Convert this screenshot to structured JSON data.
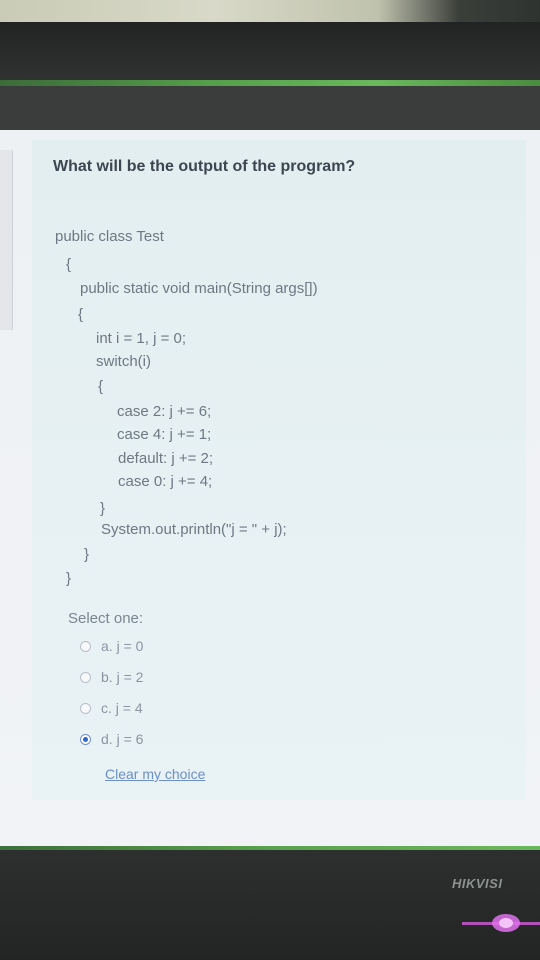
{
  "question": "What will be the output of the program?",
  "code": [
    "public class Test",
    "{",
    "public static void main(String args[])",
    "{",
    "int i = 1, j = 0;",
    "switch(i)",
    "{",
    "case 2: j += 6;",
    "case 4: j += 1;",
    "default: j += 2;",
    "case 0: j += 4;",
    "}",
    "System.out.println(\"j = \" + j);",
    "}",
    "}"
  ],
  "select_label": "Select one:",
  "options": [
    {
      "label": "a. j = 0",
      "checked": false
    },
    {
      "label": "b. j = 2",
      "checked": false
    },
    {
      "label": "c. j = 4",
      "checked": false
    },
    {
      "label": "d. j = 6",
      "checked": true
    }
  ],
  "clear_label": "Clear my choice",
  "monitor_brand": "HIKVISI",
  "colors": {
    "panel": "#e5f0f2",
    "question_text": "#3d4650",
    "code_text": "#6e7883",
    "link": "#6d8fc6",
    "radio_selected": "#2f66d0",
    "monitor_strip": "#56a04b"
  }
}
